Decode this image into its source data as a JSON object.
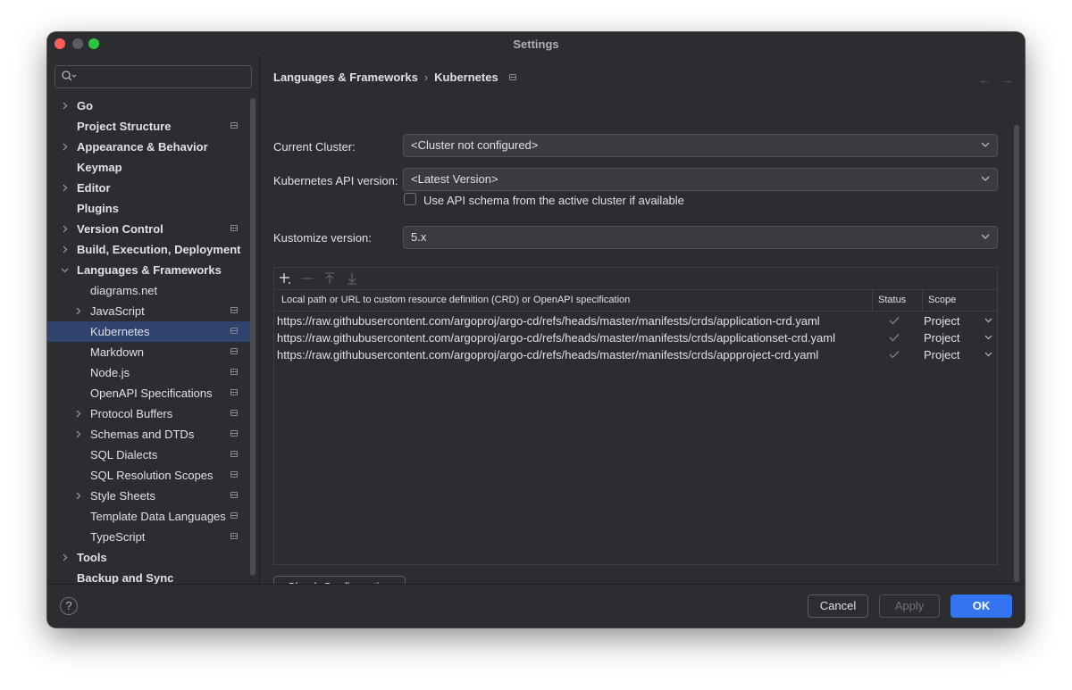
{
  "window": {
    "title": "Settings"
  },
  "search": {
    "placeholder": ""
  },
  "sidebar": {
    "items": [
      {
        "label": "Go",
        "bold": true,
        "level": 0,
        "chevron": true,
        "project_icon": false
      },
      {
        "label": "Project Structure",
        "bold": true,
        "level": 0,
        "chevron": false,
        "project_icon": true
      },
      {
        "label": "Appearance & Behavior",
        "bold": true,
        "level": 0,
        "chevron": true,
        "project_icon": false
      },
      {
        "label": "Keymap",
        "bold": true,
        "level": 0,
        "chevron": false,
        "project_icon": false
      },
      {
        "label": "Editor",
        "bold": true,
        "level": 0,
        "chevron": true,
        "project_icon": false
      },
      {
        "label": "Plugins",
        "bold": true,
        "level": 0,
        "chevron": false,
        "project_icon": false
      },
      {
        "label": "Version Control",
        "bold": true,
        "level": 0,
        "chevron": true,
        "project_icon": true
      },
      {
        "label": "Build, Execution, Deployment",
        "bold": true,
        "level": 0,
        "chevron": true,
        "project_icon": false
      },
      {
        "label": "Languages & Frameworks",
        "bold": true,
        "level": 0,
        "chevron": true,
        "expanded": true,
        "project_icon": false
      },
      {
        "label": "diagrams.net",
        "bold": false,
        "level": 1,
        "chevron": false,
        "project_icon": false
      },
      {
        "label": "JavaScript",
        "bold": false,
        "level": 1,
        "chevron": true,
        "project_icon": true
      },
      {
        "label": "Kubernetes",
        "bold": false,
        "level": 1,
        "chevron": false,
        "project_icon": true,
        "selected": true
      },
      {
        "label": "Markdown",
        "bold": false,
        "level": 1,
        "chevron": false,
        "project_icon": true
      },
      {
        "label": "Node.js",
        "bold": false,
        "level": 1,
        "chevron": false,
        "project_icon": true
      },
      {
        "label": "OpenAPI Specifications",
        "bold": false,
        "level": 1,
        "chevron": false,
        "project_icon": true
      },
      {
        "label": "Protocol Buffers",
        "bold": false,
        "level": 1,
        "chevron": true,
        "project_icon": true
      },
      {
        "label": "Schemas and DTDs",
        "bold": false,
        "level": 1,
        "chevron": true,
        "project_icon": true
      },
      {
        "label": "SQL Dialects",
        "bold": false,
        "level": 1,
        "chevron": false,
        "project_icon": true
      },
      {
        "label": "SQL Resolution Scopes",
        "bold": false,
        "level": 1,
        "chevron": false,
        "project_icon": true
      },
      {
        "label": "Style Sheets",
        "bold": false,
        "level": 1,
        "chevron": true,
        "project_icon": true
      },
      {
        "label": "Template Data Languages",
        "bold": false,
        "level": 1,
        "chevron": false,
        "project_icon": true
      },
      {
        "label": "TypeScript",
        "bold": false,
        "level": 1,
        "chevron": false,
        "project_icon": true
      },
      {
        "label": "Tools",
        "bold": true,
        "level": 0,
        "chevron": true,
        "project_icon": false
      },
      {
        "label": "Backup and Sync",
        "bold": true,
        "level": 0,
        "chevron": false,
        "project_icon": false
      }
    ]
  },
  "breadcrumb": {
    "parent": "Languages & Frameworks",
    "separator": "›",
    "current": "Kubernetes"
  },
  "form": {
    "cluster_label": "Current Cluster:",
    "cluster_value": "<Cluster not configured>",
    "api_label": "Kubernetes API version:",
    "api_value": "<Latest Version>",
    "schema_checkbox_label": "Use API schema from the active cluster if available",
    "schema_checked": false,
    "kustomize_label": "Kustomize version:",
    "kustomize_value": "5.x"
  },
  "crd_table": {
    "headers": {
      "path": "Local path or URL to custom resource definition (CRD) or OpenAPI specification",
      "status": "Status",
      "scope": "Scope"
    },
    "rows": [
      {
        "url": "https://raw.githubusercontent.com/argoproj/argo-cd/refs/heads/master/manifests/crds/application-crd.yaml",
        "scope": "Project"
      },
      {
        "url": "https://raw.githubusercontent.com/argoproj/argo-cd/refs/heads/master/manifests/crds/applicationset-crd.yaml",
        "scope": "Project"
      },
      {
        "url": "https://raw.githubusercontent.com/argoproj/argo-cd/refs/heads/master/manifests/crds/appproject-crd.yaml",
        "scope": "Project"
      }
    ]
  },
  "buttons": {
    "check_configuration": "Check Configuration",
    "cancel": "Cancel",
    "apply": "Apply",
    "ok": "OK",
    "help": "?"
  },
  "colors": {
    "background": "#2b2d30",
    "selection": "#2e436e",
    "accent": "#3574f0",
    "text": "#dfe1e5"
  }
}
